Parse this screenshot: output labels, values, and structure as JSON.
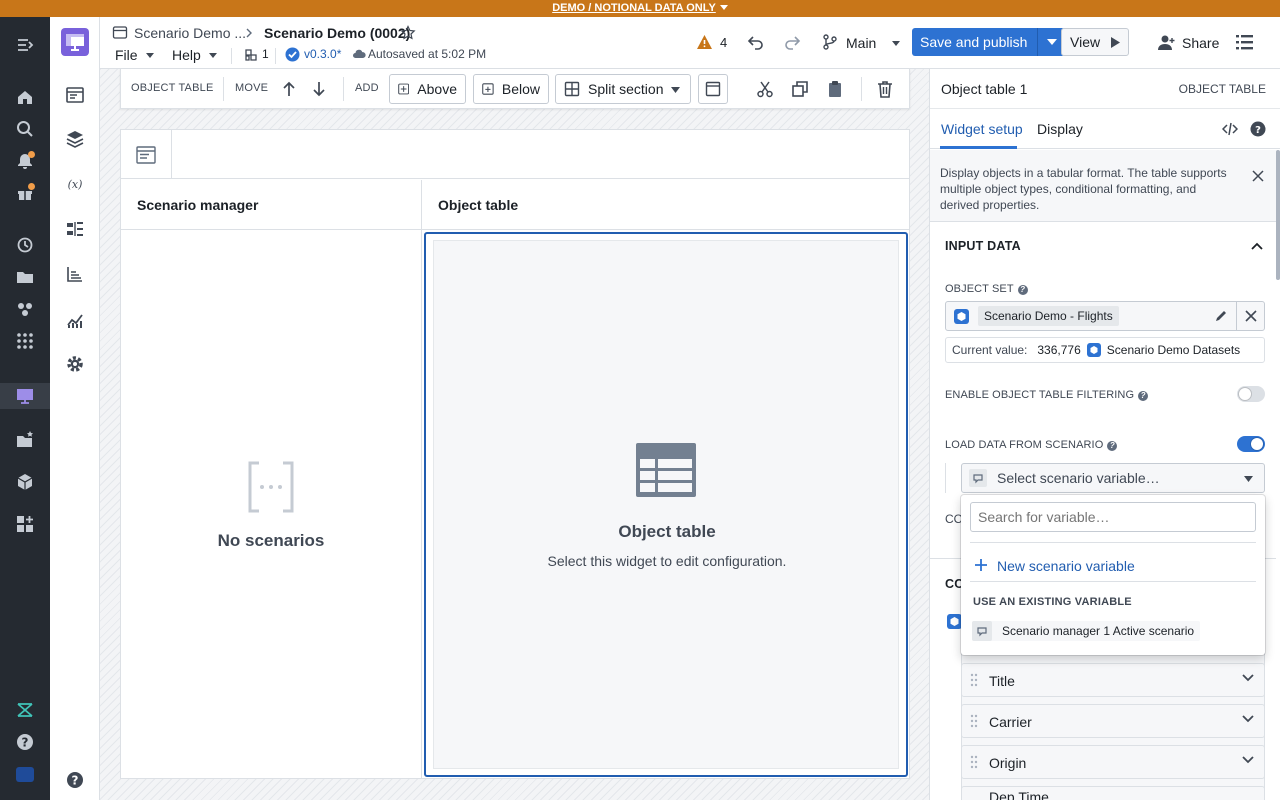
{
  "banner": {
    "text": "DEMO / NOTIONAL DATA ONLY"
  },
  "colors": {
    "accent": "#2d72d2",
    "banner": "#c87619",
    "nav_bg": "#252a31",
    "warning": "#c87619"
  },
  "header": {
    "breadcrumb_parent": "Scenario Demo ...",
    "title": "Scenario Demo (0002)",
    "menu_file": "File",
    "menu_help": "Help",
    "pages_count": "1",
    "version": "v0.3.0*",
    "autosave": "Autosaved at 5:02 PM",
    "warnings_count": "4",
    "branch": "Main",
    "save_label": "Save and publish",
    "view_label": "View",
    "share_label": "Share"
  },
  "toolbar": {
    "object_table_label": "OBJECT TABLE",
    "move_label": "MOVE",
    "add_label": "ADD",
    "above_label": "Above",
    "below_label": "Below",
    "split_label": "Split section"
  },
  "canvas": {
    "scenario_header": "Scenario manager",
    "object_header": "Object table",
    "empty_label": "No scenarios",
    "widget_title": "Object table",
    "widget_hint": "Select this widget to edit configuration."
  },
  "panel": {
    "title": "Object table 1",
    "type": "OBJECT TABLE",
    "tab_setup": "Widget setup",
    "tab_display": "Display",
    "description": "Display objects in a tabular format. The table supports multiple object types, conditional formatting, and derived properties.",
    "input_data": "INPUT DATA",
    "object_set_label": "OBJECT SET",
    "object_set_value": "Scenario Demo - Flights",
    "current_value_label": "Current value:",
    "current_value_count": "336,776",
    "current_value_source": "Scenario Demo Datasets",
    "filtering_label": "ENABLE OBJECT TABLE FILTERING",
    "filtering_enabled": false,
    "load_scenario_label": "LOAD DATA FROM SCENARIO",
    "load_scenario_enabled": true,
    "select_placeholder": "Select scenario variable…",
    "partial_1": "COI",
    "partial_2": "CO",
    "dropdown": {
      "search_placeholder": "Search for variable…",
      "new_variable": "New scenario variable",
      "existing_header": "USE AN EXISTING VARIABLE",
      "existing_item": "Scenario manager 1 Active scenario"
    },
    "columns": [
      "Title",
      "Carrier",
      "Origin",
      "Dep Time"
    ]
  }
}
